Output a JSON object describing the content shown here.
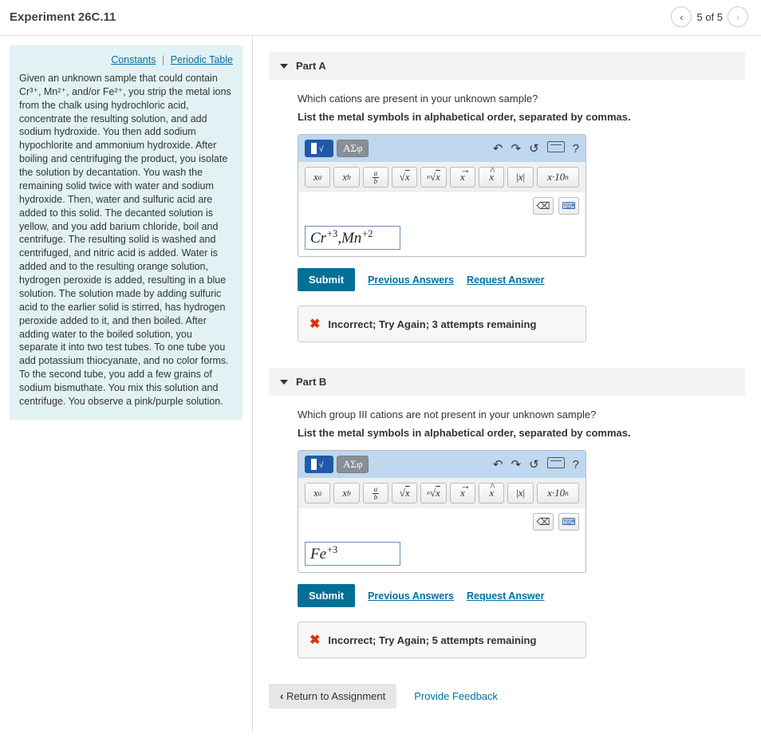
{
  "header": {
    "title": "Experiment 26C.11",
    "pager_text": "5 of 5"
  },
  "info": {
    "link_constants": "Constants",
    "link_periodic": "Periodic Table",
    "body": "Given an unknown sample that could contain Cr³⁺, Mn²⁺, and/or Fe²⁺, you strip the metal ions from the chalk using hydrochloric acid, concentrate the resulting solution, and add sodium hydroxide.  You then add sodium hypochlorite and ammonium hydroxide.   After boiling and centrifuging the product, you isolate the solution by decantation.  You wash the remaining solid twice with water and sodium hydroxide.  Then, water and sulfuric acid are added to this solid.  The decanted solution is yellow, and you add barium chloride, boil and centrifuge.  The resulting solid is washed and centrifuged, and nitric acid is added.  Water is added and to the resulting orange solution, hydrogen peroxide is added, resulting in a blue solution.  The solution made by adding sulfuric acid to the earlier solid is stirred, has hydrogen peroxide added to it, and then boiled.  After adding water to the boiled solution, you separate it into two test tubes.  To one tube you add potassium thiocyanate, and no color forms.  To the second tube, you add a few grains of sodium bismuthate.  You mix this solution and centrifuge.  You observe a pink/purple solution."
  },
  "parts": [
    {
      "label": "Part A",
      "question": "Which cations are present in your unknown sample?",
      "instruction": "List the metal symbols in alphabetical order, separated by commas.",
      "answer_html": "<i>Cr</i><sup>+3</sup>,<i>Mn</i><sup>+2</sup>",
      "feedback": "Incorrect; Try Again; 3 attempts remaining"
    },
    {
      "label": "Part B",
      "question": "Which group III cations are not present in your unknown sample?",
      "instruction": "List the metal symbols in alphabetical order, separated by commas.",
      "answer_html": "<i>Fe</i><sup>+3</sup>",
      "feedback": "Incorrect; Try Again; 5 attempts remaining"
    }
  ],
  "toolbar": {
    "greek": "ΑΣφ",
    "buttons": {
      "xa": "xᵃ",
      "xb": "x_b",
      "sqrt": "√x",
      "nroot": "ⁿ√x",
      "vec": "x⃗",
      "hat": "x̂",
      "abs": "|x|",
      "sci": "x·10ⁿ"
    }
  },
  "actions": {
    "submit": "Submit",
    "previous": "Previous Answers",
    "request": "Request Answer"
  },
  "footer": {
    "return": "Return to Assignment",
    "feedback": "Provide Feedback"
  }
}
